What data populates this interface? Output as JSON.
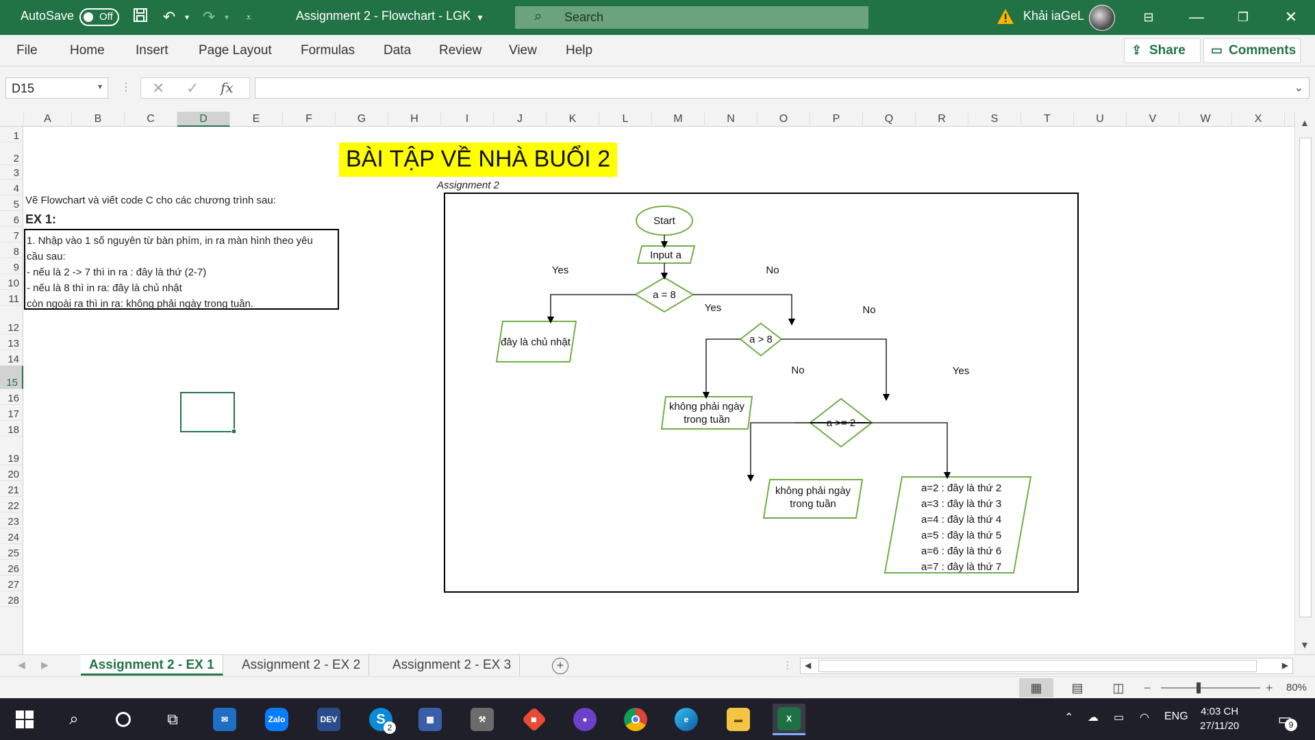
{
  "titlebar": {
    "autosave_label": "AutoSave",
    "autosave_state": "Off",
    "doc_title": "Assignment 2 - Flowchart - LGK",
    "search_placeholder": "Search",
    "user_name": "Khải iaGeL"
  },
  "ribbon": {
    "tabs": [
      "File",
      "Home",
      "Insert",
      "Page Layout",
      "Formulas",
      "Data",
      "Review",
      "View",
      "Help"
    ],
    "share_label": "Share",
    "comments_label": "Comments"
  },
  "formula_bar": {
    "name_box": "D15",
    "fx_label": "fx",
    "formula": ""
  },
  "columns": [
    "A",
    "B",
    "C",
    "D",
    "E",
    "F",
    "G",
    "H",
    "I",
    "J",
    "K",
    "L",
    "M",
    "N",
    "O",
    "P",
    "Q",
    "R",
    "S",
    "T",
    "U",
    "V",
    "W",
    "X"
  ],
  "selected_column": "D",
  "rows": [
    "1",
    "2",
    "3",
    "4",
    "5",
    "6",
    "7",
    "8",
    "9",
    "10",
    "11",
    "12",
    "13",
    "14",
    "15",
    "16",
    "17",
    "18",
    "19",
    "20",
    "21",
    "22",
    "23",
    "24",
    "25",
    "26",
    "27",
    "28"
  ],
  "selected_row": "15",
  "sheet": {
    "banner": "BÀI TẬP VỀ NHÀ BUỔI 2",
    "caption": "Assignment 2",
    "instruction": "Vẽ Flowchart và viết code C cho các chương trình sau:",
    "ex_title": "EX 1:",
    "ex_lines": [
      "1. Nhập vào 1 số nguyên từ bàn phím, in ra màn hình theo yêu",
      "cầu sau:",
      "- nếu là 2 -> 7 thì in ra : đây là thứ (2-7)",
      "- nếu là 8 thì in ra: đây là chủ nhật",
      "còn ngoài ra thì in ra: không phải ngày trong tuần."
    ]
  },
  "flowchart": {
    "start": "Start",
    "input": "Input a",
    "dec1": "a = 8",
    "dec1_yes": "Yes",
    "dec1_no": "No",
    "out_sunday": "đây là chủ nhật",
    "dec2": "a > 8",
    "dec2_yes": "Yes",
    "dec2_no": "No",
    "out_not_week_1a": "không phải ngày",
    "out_not_week_1b": "trong tuần",
    "dec3": "a >= 2",
    "dec3_no": "No",
    "dec3_yes": "Yes",
    "out_not_week_2a": "không phải ngày",
    "out_not_week_2b": "trong tuần",
    "days": [
      "a=2 : đây là thứ 2",
      "a=3 : đây là thứ 3",
      "a=4 : đây là thứ 4",
      "a=5 : đây là thứ 5",
      "a=6 : đây là thứ 6",
      "a=7 : đây là thứ 7"
    ],
    "accent_color": "#70ad47"
  },
  "sheet_tabs": [
    "Assignment 2 - EX 1",
    "Assignment 2 - EX 2",
    "Assignment 2 - EX 3"
  ],
  "active_sheet": "Assignment 2 - EX 1",
  "statusbar": {
    "zoom": "80%"
  },
  "taskbar": {
    "apps": [
      "start-icon",
      "search-icon",
      "cortana-icon",
      "task-view-icon",
      "mail-icon",
      "zalo-icon",
      "devcpp-icon",
      "skype-icon",
      "calculator-icon",
      "tools-icon",
      "git-icon",
      "github-icon",
      "chrome-icon",
      "edge-icon",
      "file-explorer-icon",
      "excel-icon"
    ],
    "skype_badge": "2",
    "zalo_label": "Zalo",
    "dev_label": "DEV",
    "lang": "ENG",
    "time": "4:03 CH",
    "date": "27/11/20",
    "notif_count": "9"
  },
  "colors": {
    "excel_green": "#217346",
    "banner_yellow": "#ffff00"
  }
}
